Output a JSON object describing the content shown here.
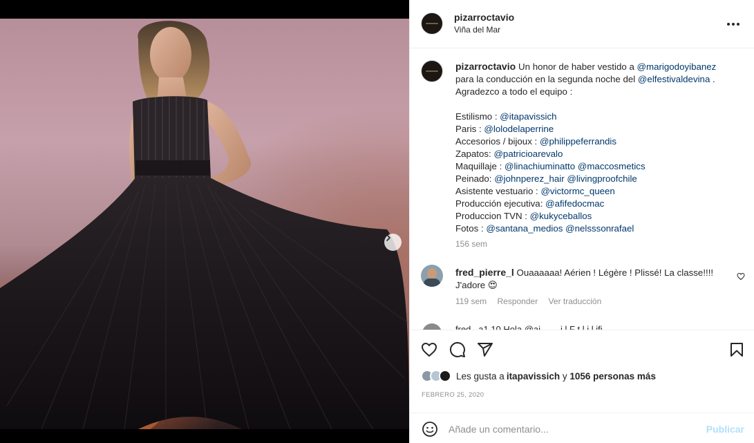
{
  "post": {
    "username": "pizarroctavio",
    "location": "Viña del Mar",
    "carousel": {
      "total": 3,
      "active": 1
    }
  },
  "caption": {
    "username": "pizarroctavio",
    "lines": [
      [
        {
          "t": "Un honor de haber vestido a "
        },
        {
          "t": "@marigodoyibanez",
          "m": true
        }
      ],
      [
        {
          "t": "para la conducción en la segunda noche del "
        },
        {
          "t": "@elfestivaldevina",
          "m": true
        },
        {
          "t": " ."
        }
      ],
      [
        {
          "t": "Agradezco a todo el equipo :"
        }
      ],
      [],
      [
        {
          "t": "Estilismo : "
        },
        {
          "t": "@itapavissich",
          "m": true
        }
      ],
      [
        {
          "t": "Paris : "
        },
        {
          "t": "@lolodelaperrine",
          "m": true
        }
      ],
      [
        {
          "t": "Accesorios / bijoux : "
        },
        {
          "t": "@philippeferrandis",
          "m": true
        }
      ],
      [
        {
          "t": "Zapatos: "
        },
        {
          "t": "@patricioarevalo",
          "m": true
        }
      ],
      [
        {
          "t": "Maquillaje : "
        },
        {
          "t": "@linachiuminatto",
          "m": true
        },
        {
          "t": " "
        },
        {
          "t": "@maccosmetics",
          "m": true
        }
      ],
      [
        {
          "t": "Peinado: "
        },
        {
          "t": "@johnperez_hair",
          "m": true
        },
        {
          "t": " "
        },
        {
          "t": "@livingproofchile",
          "m": true
        }
      ],
      [
        {
          "t": "Asistente vestuario : "
        },
        {
          "t": "@victormc_queen",
          "m": true
        }
      ],
      [
        {
          "t": "Producción ejecutiva: "
        },
        {
          "t": "@afifedocmac",
          "m": true
        }
      ],
      [
        {
          "t": "Produccion TVN : "
        },
        {
          "t": "@kukyceballos",
          "m": true
        }
      ],
      [
        {
          "t": "Fotos : "
        },
        {
          "t": "@santana_medios",
          "m": true
        },
        {
          "t": " "
        },
        {
          "t": "@nelsssonrafael",
          "m": true
        }
      ]
    ],
    "time": "156 sem"
  },
  "comments": [
    {
      "username": "fred_pierre_l",
      "text_line1": "Ouaaaaaa! Aérien ! Légère ! Plissé! La classe!!!!",
      "text_line2": "J'adore 😍",
      "time": "119 sem",
      "reply": "Responder",
      "translate": "Ver traducción"
    }
  ],
  "next_comment_partial": "fred_ a1 10 Hola @ai ... .. i   l F t     l i   l    ifi",
  "likes": {
    "prefix": "Les gusta a ",
    "user": "itapavissich",
    "middle": " y ",
    "count": "1056 personas más"
  },
  "date": "FEBRERO 25, 2020",
  "composer": {
    "placeholder": "Añade un comentario...",
    "publish": "Publicar"
  },
  "colors": {
    "mention": "#00376b",
    "meta": "#8e8e8e",
    "publish_disabled": "#b2dffc",
    "heart_emoji": "#ed4956"
  },
  "icons": [
    "more-options-icon",
    "heart-icon",
    "comment-icon",
    "share-icon",
    "save-icon",
    "emoji-icon",
    "chevron-right-icon"
  ]
}
